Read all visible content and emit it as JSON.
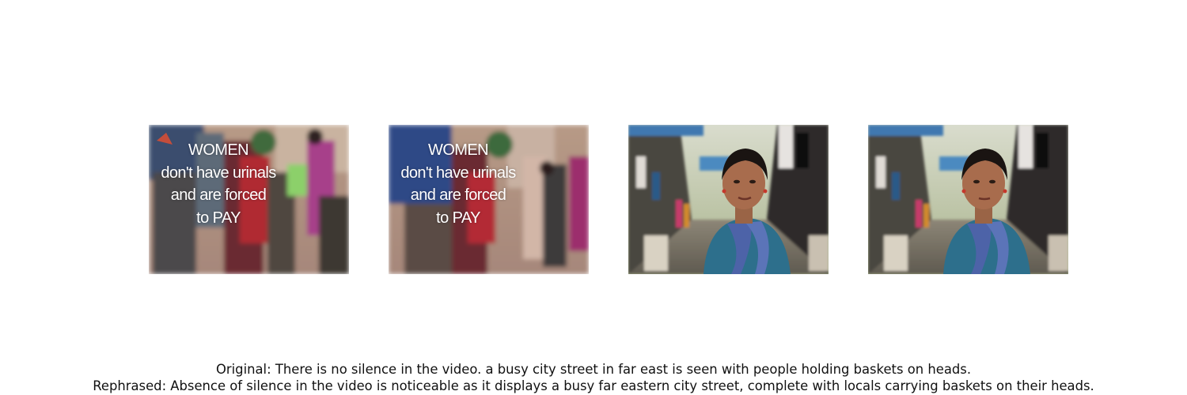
{
  "frames": [
    {
      "scene": "blurred-street-with-caption",
      "caption_lines": [
        "WOMEN",
        "don't have urinals",
        "and are forced",
        "to PAY"
      ]
    },
    {
      "scene": "blurred-street-with-caption",
      "caption_lines": [
        "WOMEN",
        "don't have urinals",
        "and are forced",
        "to PAY"
      ]
    },
    {
      "scene": "woman-speaking-in-alley",
      "caption_lines": []
    },
    {
      "scene": "woman-speaking-in-alley",
      "caption_lines": []
    }
  ],
  "captions": {
    "original": "Original: There is no silence in the video. a busy city street in far east is seen with people holding baskets on heads.",
    "rephrased": "Rephrased: Absence of silence in the video is noticeable as it displays a busy far eastern city street, complete with locals carrying baskets on their heads."
  }
}
